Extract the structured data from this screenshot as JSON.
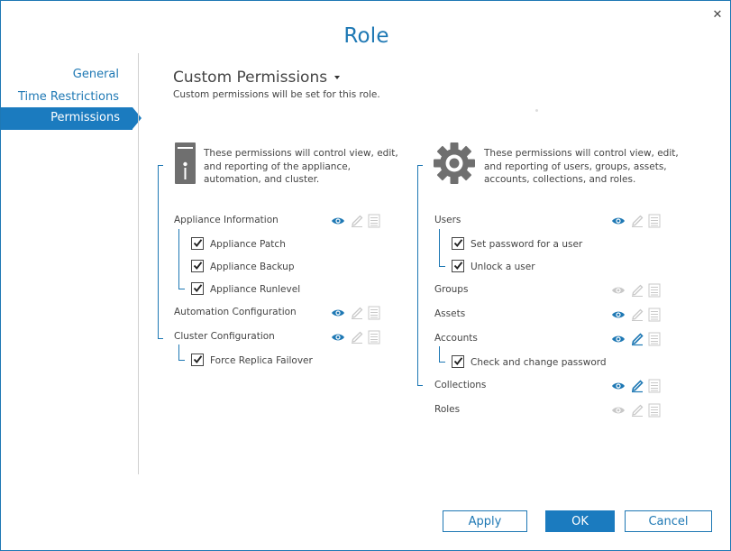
{
  "dialog": {
    "title": "Role",
    "close_glyph": "✕",
    "buttons": {
      "apply": "Apply",
      "ok": "OK",
      "cancel": "Cancel"
    }
  },
  "nav": {
    "items": [
      {
        "label": "General",
        "active": false
      },
      {
        "label": "Time Restrictions",
        "active": false
      },
      {
        "label": "Permissions",
        "active": true
      }
    ]
  },
  "header": {
    "title": "Custom Permissions",
    "subtitle": "Custom permissions will be set for this role."
  },
  "left": {
    "icon": "server-icon",
    "description": [
      "These permissions will control view, edit,",
      "and reporting of the appliance,",
      "automation, and cluster."
    ],
    "groups": [
      {
        "label": "Appliance Information",
        "view": true,
        "edit": false,
        "report": false,
        "children": [
          {
            "label": "Appliance Patch",
            "checked": true
          },
          {
            "label": "Appliance Backup",
            "checked": true
          },
          {
            "label": "Appliance Runlevel",
            "checked": true
          }
        ]
      },
      {
        "label": "Automation Configuration",
        "view": true,
        "edit": false,
        "report": false,
        "children": []
      },
      {
        "label": "Cluster Configuration",
        "view": true,
        "edit": false,
        "report": false,
        "children": [
          {
            "label": "Force Replica Failover",
            "checked": true
          }
        ]
      }
    ]
  },
  "right": {
    "icon": "gear-icon",
    "description": [
      "These permissions will control view, edit,",
      "and reporting of users, groups, assets,",
      "accounts, collections, and roles."
    ],
    "groups": [
      {
        "label": "Users",
        "view": true,
        "edit": false,
        "report": false,
        "children": [
          {
            "label": "Set password for a user",
            "checked": true
          },
          {
            "label": "Unlock a user",
            "checked": true
          }
        ]
      },
      {
        "label": "Groups",
        "view": false,
        "edit": false,
        "report": false,
        "children": []
      },
      {
        "label": "Assets",
        "view": true,
        "edit": false,
        "report": false,
        "children": []
      },
      {
        "label": "Accounts",
        "view": true,
        "edit": true,
        "report": false,
        "children": [
          {
            "label": "Check and change password",
            "checked": true
          }
        ]
      },
      {
        "label": "Collections",
        "view": true,
        "edit": true,
        "report": false,
        "children": []
      },
      {
        "label": "Roles",
        "view": false,
        "edit": false,
        "report": false,
        "children": []
      }
    ]
  },
  "colors": {
    "accent": "#1e78b4",
    "active_nav": "#1b7bbf",
    "muted_icon": "#c8c8c8",
    "text": "#444444"
  }
}
